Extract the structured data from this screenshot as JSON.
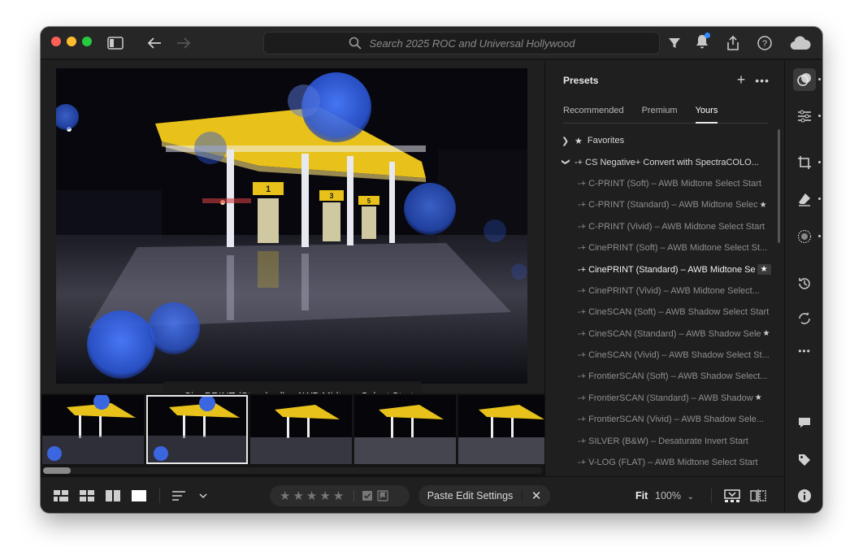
{
  "toolbar": {
    "search_placeholder": "Search 2025 ROC and Universal Hollywood"
  },
  "photo": {
    "pump_numbers": [
      "1",
      "3",
      "5"
    ],
    "caption": "-+ CinePRINT (Standard) – AWB Midtone Select Start"
  },
  "presets": {
    "title": "Presets",
    "tabs": [
      "Recommended",
      "Premium",
      "Yours"
    ],
    "active_tab": "Yours",
    "favorites_label": "Favorites",
    "group_label": "-+ CS Negative+ Convert with SpectraCOLO...",
    "items": [
      {
        "label": "-+ C-PRINT (Soft) – AWB Midtone Select Start",
        "starred": false,
        "active": false
      },
      {
        "label": "-+ C-PRINT (Standard) – AWB Midtone Selec",
        "starred": true,
        "active": false
      },
      {
        "label": "-+ C-PRINT (Vivid) – AWB Midtone Select Start",
        "starred": false,
        "active": false
      },
      {
        "label": "-+ CinePRINT (Soft) – AWB Midtone Select St...",
        "starred": false,
        "active": false
      },
      {
        "label": "-+ CinePRINT (Standard) – AWB Midtone Se",
        "starred": true,
        "active": true
      },
      {
        "label": "-+ CinePRINT (Vivid) – AWB Midtone Select...",
        "starred": false,
        "active": false
      },
      {
        "label": "-+ CineSCAN (Soft) – AWB Shadow Select Start",
        "starred": false,
        "active": false
      },
      {
        "label": "-+ CineSCAN (Standard) – AWB Shadow Sele",
        "starred": true,
        "active": false
      },
      {
        "label": "-+ CineSCAN (Vivid) – AWB Shadow Select St...",
        "starred": false,
        "active": false
      },
      {
        "label": "-+ FrontierSCAN (Soft) – AWB Shadow Select...",
        "starred": false,
        "active": false
      },
      {
        "label": "-+ FrontierSCAN (Standard) – AWB Shadow",
        "starred": true,
        "active": false
      },
      {
        "label": "-+ FrontierSCAN (Vivid) – AWB Shadow Sele...",
        "starred": false,
        "active": false
      },
      {
        "label": "-+ SILVER (B&W) – Desaturate Invert Start",
        "starred": false,
        "active": false
      },
      {
        "label": "-+ V-LOG (FLAT) – AWB Midtone Select Start",
        "starred": false,
        "active": false
      }
    ]
  },
  "bottombar": {
    "stars": "★★★★★",
    "paste_label": "Paste Edit Settings",
    "fit_label": "Fit",
    "zoom_label": "100%"
  },
  "colors": {
    "accent_blue": "#2f8cff",
    "canopy_yellow": "#e8c21a",
    "bokeh_blue": "#2f5fd6"
  }
}
